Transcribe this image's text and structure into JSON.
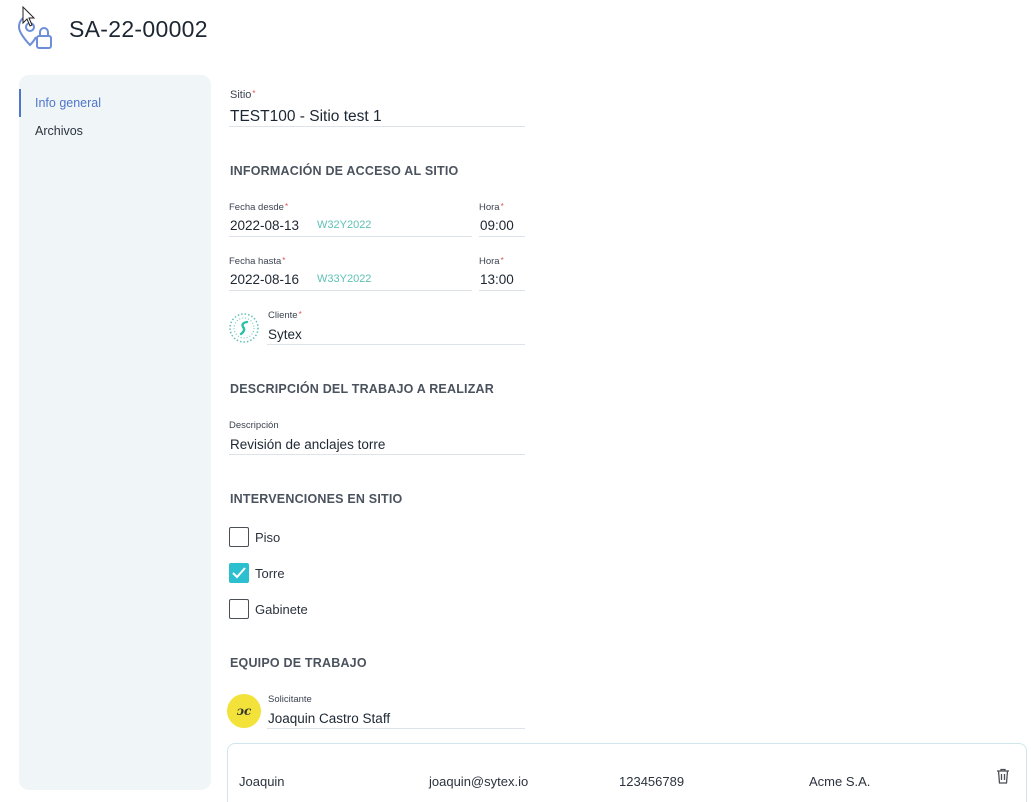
{
  "header": {
    "title": "SA-22-00002",
    "icon": "location-lock-icon"
  },
  "sidebar": {
    "items": [
      {
        "label": "Info general",
        "active": true
      },
      {
        "label": "Archivos",
        "active": false
      }
    ]
  },
  "form": {
    "sitio": {
      "label": "Sitio",
      "required_mark": "*",
      "value": "TEST100 - Sitio test 1"
    },
    "access_section": "INFORMACIÓN DE ACCESO AL SITIO",
    "fecha_desde": {
      "label": "Fecha desde",
      "required_mark": "*",
      "value": "2022-08-13",
      "week": "W32Y2022"
    },
    "hora_desde": {
      "label": "Hora",
      "required_mark": "*",
      "value": "09:00"
    },
    "fecha_hasta": {
      "label": "Fecha hasta",
      "required_mark": "*",
      "value": "2022-08-16",
      "week": "W33Y2022"
    },
    "hora_hasta": {
      "label": "Hora",
      "required_mark": "*",
      "value": "13:00"
    },
    "cliente": {
      "label": "Cliente",
      "required_mark": "*",
      "value": "Sytex",
      "logo": "sytex-logo"
    },
    "work_section": "DESCRIPCIÓN DEL TRABAJO A REALIZAR",
    "descripcion": {
      "label": "Descripción",
      "value": "Revisión de anclajes torre"
    },
    "interventions_section": "INTERVENCIONES EN SITIO",
    "interventions": [
      {
        "label": "Piso",
        "checked": false
      },
      {
        "label": "Torre",
        "checked": true
      },
      {
        "label": "Gabinete",
        "checked": false
      }
    ],
    "team_section": "EQUIPO DE TRABAJO",
    "solicitante": {
      "label": "Solicitante",
      "value": "Joaquin Castro Staff",
      "avatar_initials": "JC",
      "avatar_color": "#f2e23a"
    },
    "team_member": {
      "name": "Joaquin",
      "email": "joaquin@sytex.io",
      "phone": "123456789",
      "company": "Acme S.A.",
      "delete_icon": "trash-icon"
    }
  },
  "colors": {
    "accent": "#4f76c9",
    "checkbox_checked": "#2bbfd0",
    "week_tag": "#5fc0b6",
    "required": "#e0524e",
    "sidebar_bg": "#f0f5f8"
  }
}
